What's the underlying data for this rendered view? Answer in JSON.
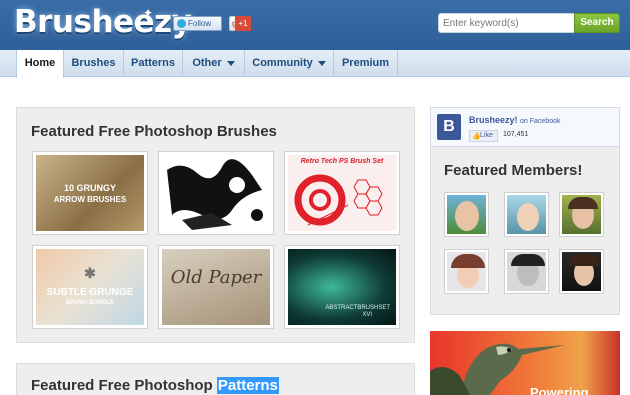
{
  "header": {
    "logo_text": "Brusheezy",
    "follow_label": "Follow Us!",
    "gplus_label": "+1",
    "search_placeholder": "Enter keyword(s)",
    "search_button": "Search"
  },
  "nav": {
    "items": [
      {
        "label": "Home",
        "active": true,
        "dropdown": false
      },
      {
        "label": "Brushes",
        "active": false,
        "dropdown": false
      },
      {
        "label": "Patterns",
        "active": false,
        "dropdown": false
      },
      {
        "label": "Other",
        "active": false,
        "dropdown": true
      },
      {
        "label": "Community",
        "active": false,
        "dropdown": true
      },
      {
        "label": "Premium",
        "active": false,
        "dropdown": false
      }
    ]
  },
  "brushes": {
    "title": "Featured Free Photoshop Brushes",
    "thumbs": [
      {
        "caption_line1": "10 GRUNGY",
        "caption_line2": "ARROW BRUSHES"
      },
      {
        "caption_line1": "",
        "caption_line2": ""
      },
      {
        "caption_line1": "Retro Tech PS Brush Set",
        "caption_line2": ""
      },
      {
        "caption_line1": "SUBTLE GRUNGE",
        "caption_line2": "BRUSH BUNDLE"
      },
      {
        "caption_line1": "Old Paper",
        "caption_line2": ""
      },
      {
        "caption_line1": "ABSTRACTBRUSHSET",
        "caption_line2": "XVI"
      }
    ]
  },
  "patterns": {
    "title_prefix": "Featured Free Photoshop",
    "title_highlight": "Patterns"
  },
  "facebook": {
    "logo": "B",
    "name": "Brusheezy!",
    "on_text": "on Facebook",
    "like_label": "Like",
    "like_count": "107,451"
  },
  "members": {
    "title": "Featured Members!"
  },
  "ad": {
    "text": "Powering"
  },
  "colors": {
    "header_blue": "#3a6ea8",
    "search_green": "#7ab834",
    "highlight_blue": "#3399ff",
    "facebook_blue": "#3b5998"
  }
}
